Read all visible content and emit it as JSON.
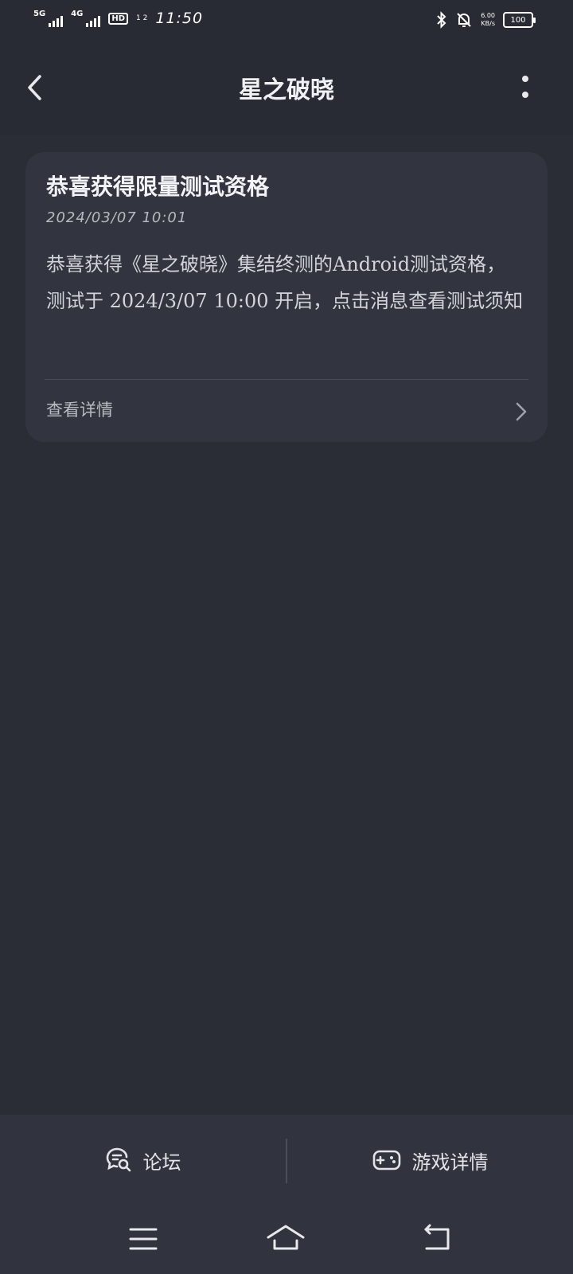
{
  "status_bar": {
    "net1": "5G",
    "net2": "4G",
    "hd": "HD",
    "hd_sub": "1 2",
    "time": "11:50",
    "speed_value": "6.00",
    "speed_unit": "KB/s",
    "battery": "100"
  },
  "header": {
    "title": "星之破晓"
  },
  "card": {
    "title": "恭喜获得限量测试资格",
    "datetime": "2024/03/07 10:01",
    "body": "恭喜获得《星之破晓》集结终测的Android测试资格，测试于 2024/3/07 10:00 开启，点击消息查看测试须知",
    "detail_label": "查看详情"
  },
  "tabs": {
    "forum": "论坛",
    "game_detail": "游戏详情"
  },
  "icons": {
    "back": "back-arrow-icon",
    "more": "more-vertical-icon",
    "forum": "forum-chat-icon",
    "game": "gamepad-icon",
    "menu": "menu-icon",
    "home": "home-icon",
    "return": "return-icon"
  }
}
